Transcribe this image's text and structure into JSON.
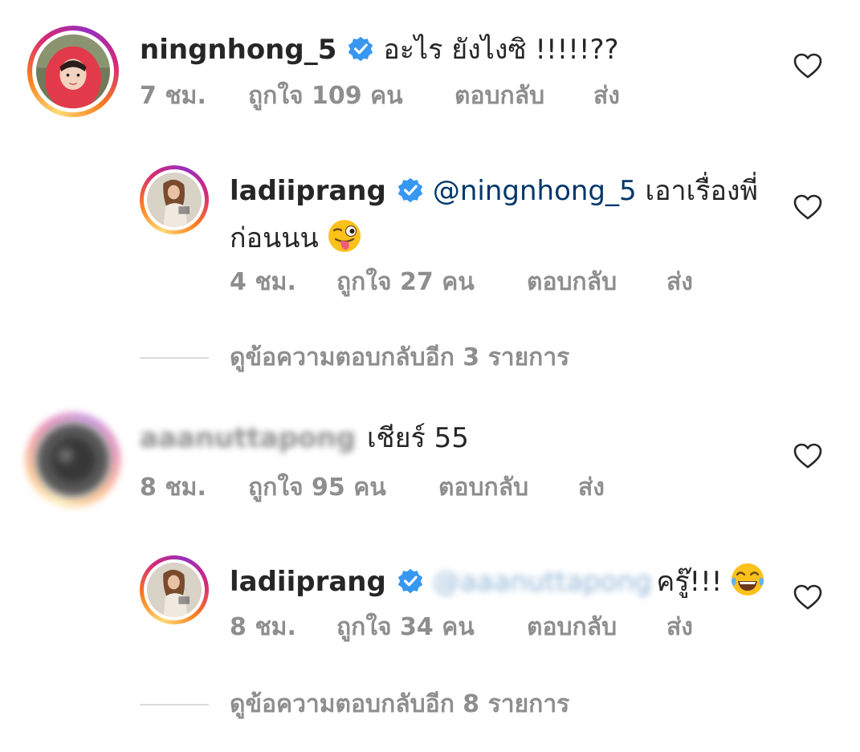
{
  "colors": {
    "text": "#262626",
    "meta": "#8e8e8e",
    "mention": "#00376b",
    "verified": "#3897f0",
    "divider": "#dbdbdb"
  },
  "comments": [
    {
      "username": "ningnhong_5",
      "verified": true,
      "text": "อะไร ยังไงซิ !!!!!??",
      "time": "7 ชม.",
      "likes": "ถูกใจ 109 คน",
      "reply": "ตอบกลับ",
      "send": "ส่ง",
      "heart_icon": "heart-outline-icon",
      "replies": [
        {
          "username": "ladiiprang",
          "verified": true,
          "mention": "@ningnhong_5",
          "text_line1": " เอาเรื่องพี่",
          "text_line2": "ก่อนนน",
          "emoji": "winking-face-with-tongue",
          "time": "4 ชม.",
          "likes": "ถูกใจ 27 คน",
          "reply": "ตอบกลับ",
          "send": "ส่ง"
        }
      ],
      "view_more": "ดูข้อความตอบกลับอีก 3 รายการ"
    },
    {
      "username": "aaanuttapong",
      "verified": false,
      "text": "เชียร์ 55",
      "time": "8 ชม.",
      "likes": "ถูกใจ 95 คน",
      "reply": "ตอบกลับ",
      "send": "ส่ง",
      "replies": [
        {
          "username": "ladiiprang",
          "verified": true,
          "mention": "@aaanuttapong",
          "text_line1": "ครู๊!!!",
          "emoji": "face-with-tears-of-joy",
          "time": "8 ชม.",
          "likes": "ถูกใจ 34 คน",
          "reply": "ตอบกลับ",
          "send": "ส่ง"
        }
      ],
      "view_more": "ดูข้อความตอบกลับอีก 8 รายการ"
    }
  ]
}
